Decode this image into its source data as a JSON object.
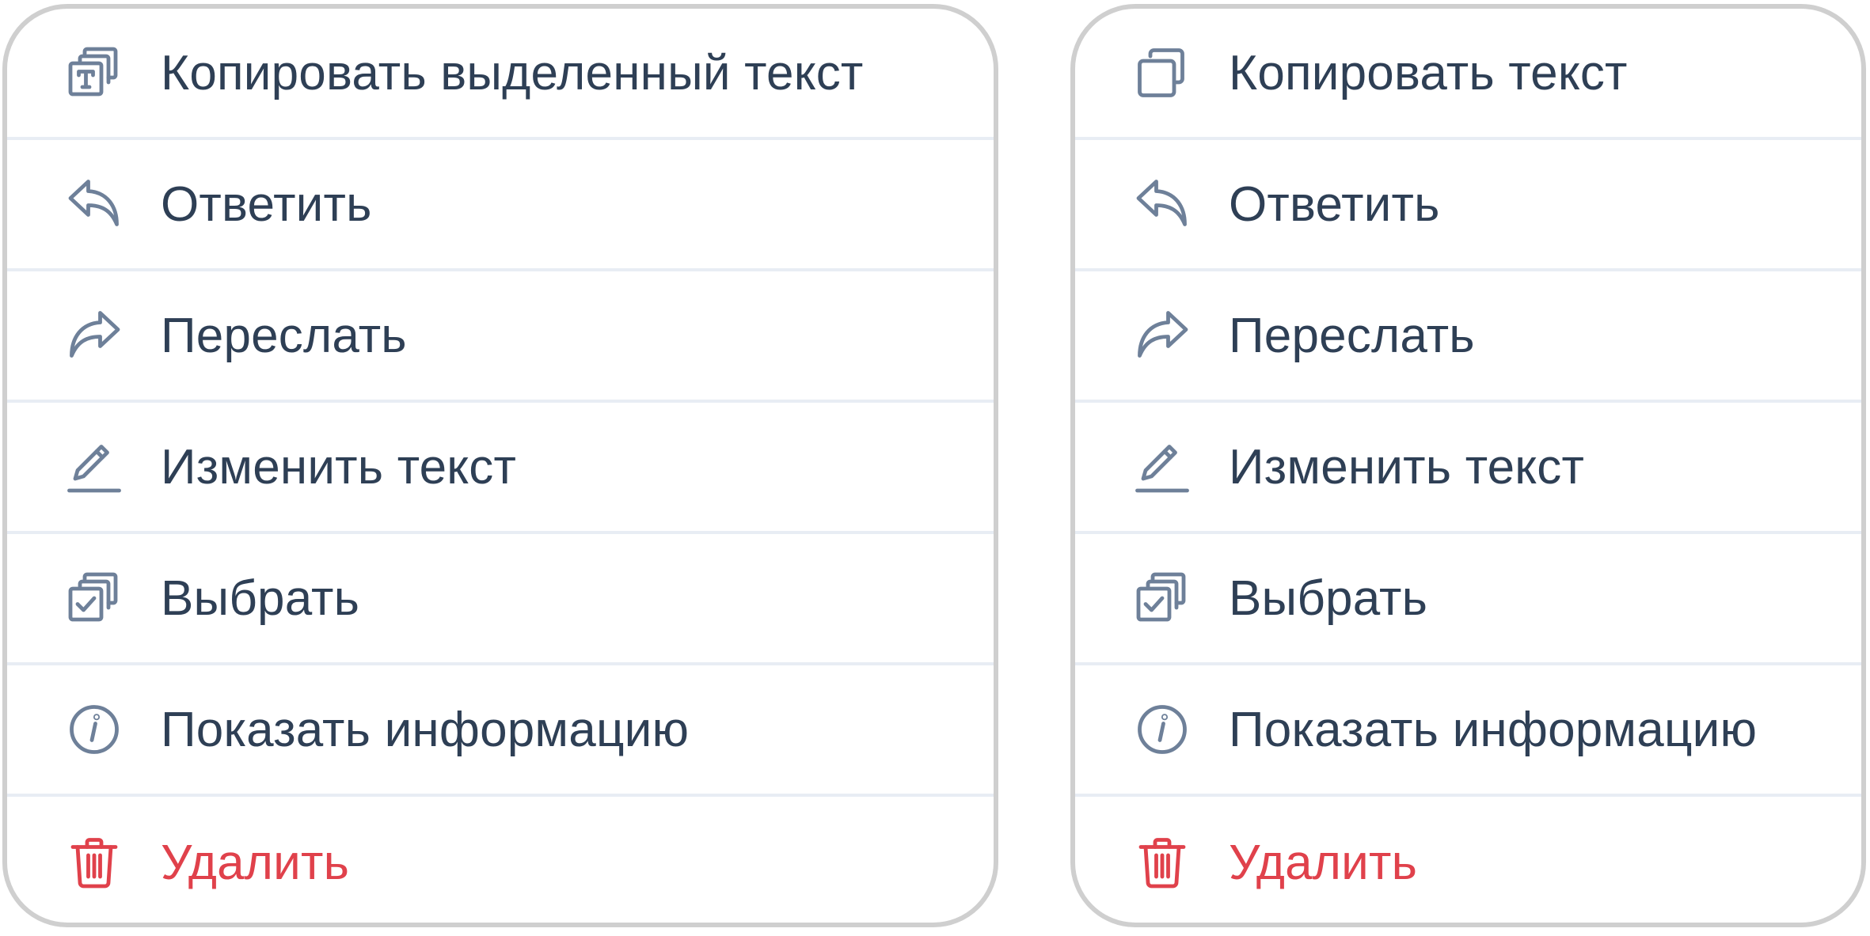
{
  "colors": {
    "text": "#2e3f55",
    "icon": "#6e8099",
    "danger": "#e0414b",
    "divider": "#e8edf4",
    "border": "#cfcfcf"
  },
  "menus": [
    {
      "items": [
        {
          "label": "Копировать выделенный текст",
          "icon": "copy-text-icon"
        },
        {
          "label": "Ответить",
          "icon": "reply-icon"
        },
        {
          "label": "Переслать",
          "icon": "forward-icon"
        },
        {
          "label": "Изменить текст",
          "icon": "edit-icon"
        },
        {
          "label": "Выбрать",
          "icon": "select-icon"
        },
        {
          "label": "Показать информацию",
          "icon": "info-icon"
        },
        {
          "label": "Удалить",
          "icon": "trash-icon"
        }
      ]
    },
    {
      "items": [
        {
          "label": "Копировать текст",
          "icon": "copy-icon"
        },
        {
          "label": "Ответить",
          "icon": "reply-icon"
        },
        {
          "label": "Переслать",
          "icon": "forward-icon"
        },
        {
          "label": "Изменить текст",
          "icon": "edit-icon"
        },
        {
          "label": "Выбрать",
          "icon": "select-icon"
        },
        {
          "label": "Показать информацию",
          "icon": "info-icon"
        },
        {
          "label": "Удалить",
          "icon": "trash-icon"
        }
      ]
    }
  ]
}
